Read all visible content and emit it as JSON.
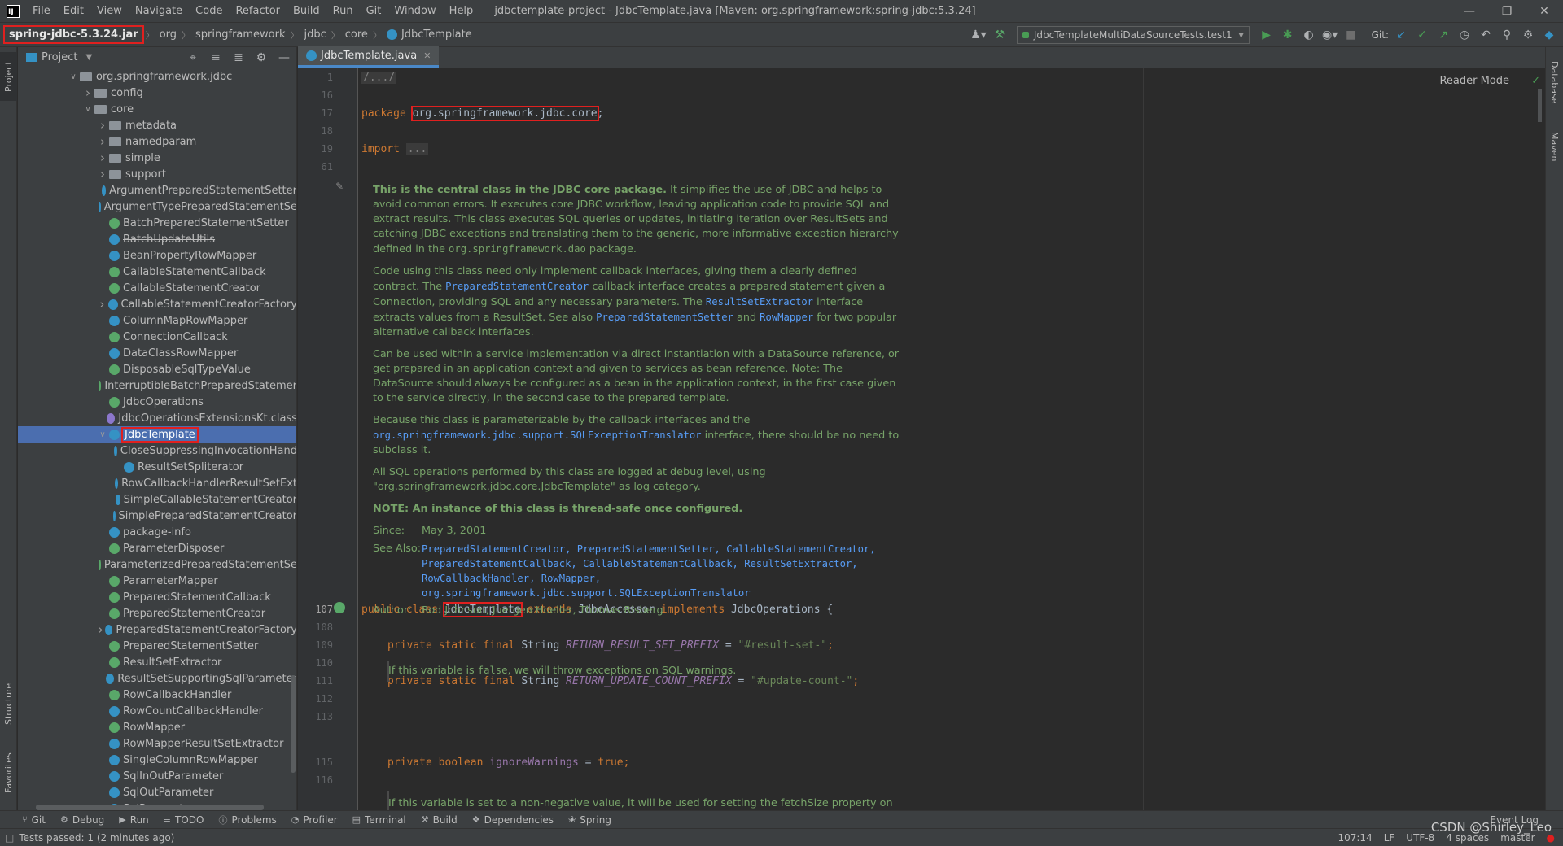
{
  "menubar": {
    "items": [
      "File",
      "Edit",
      "View",
      "Navigate",
      "Code",
      "Refactor",
      "Build",
      "Run",
      "Git",
      "Window",
      "Help"
    ],
    "window_title": "jdbctemplate-project - JdbcTemplate.java [Maven: org.springframework:spring-jdbc:5.3.24]"
  },
  "navbar": {
    "crumbs": [
      "spring-jdbc-5.3.24.jar",
      "org",
      "springframework",
      "jdbc",
      "core",
      "JdbcTemplate"
    ],
    "run_config": "JdbcTemplateMultiDataSourceTests.test1",
    "git_label": "Git:"
  },
  "left_stripe": {
    "project": "Project",
    "structure": "Structure",
    "favorites": "Favorites"
  },
  "right_stripe": {
    "database": "Database",
    "maven": "Maven"
  },
  "project_panel": {
    "title": "Project",
    "tree": [
      {
        "label": "org.springframework.jdbc",
        "type": "folder",
        "arrow": "down",
        "indent": 0
      },
      {
        "label": "config",
        "type": "folder",
        "arrow": "right",
        "indent": 1
      },
      {
        "label": "core",
        "type": "folder",
        "arrow": "down",
        "indent": 1
      },
      {
        "label": "metadata",
        "type": "folder",
        "arrow": "right",
        "indent": 2
      },
      {
        "label": "namedparam",
        "type": "folder",
        "arrow": "right",
        "indent": 2
      },
      {
        "label": "simple",
        "type": "folder",
        "arrow": "right",
        "indent": 2
      },
      {
        "label": "support",
        "type": "folder",
        "arrow": "right",
        "indent": 2
      },
      {
        "label": "ArgumentPreparedStatementSetter",
        "type": "class",
        "indent": 2
      },
      {
        "label": "ArgumentTypePreparedStatementSe",
        "type": "class",
        "indent": 2
      },
      {
        "label": "BatchPreparedStatementSetter",
        "type": "interface",
        "indent": 2
      },
      {
        "label": "BatchUpdateUtils",
        "type": "class",
        "indent": 2,
        "strike": true
      },
      {
        "label": "BeanPropertyRowMapper",
        "type": "class",
        "indent": 2
      },
      {
        "label": "CallableStatementCallback",
        "type": "interface",
        "indent": 2
      },
      {
        "label": "CallableStatementCreator",
        "type": "interface",
        "indent": 2
      },
      {
        "label": "CallableStatementCreatorFactory",
        "type": "class",
        "arrow": "right",
        "indent": 2
      },
      {
        "label": "ColumnMapRowMapper",
        "type": "class",
        "indent": 2
      },
      {
        "label": "ConnectionCallback",
        "type": "interface",
        "indent": 2
      },
      {
        "label": "DataClassRowMapper",
        "type": "class",
        "indent": 2
      },
      {
        "label": "DisposableSqlTypeValue",
        "type": "interface",
        "indent": 2
      },
      {
        "label": "InterruptibleBatchPreparedStatemer",
        "type": "interface",
        "indent": 2
      },
      {
        "label": "JdbcOperations",
        "type": "interface",
        "indent": 2
      },
      {
        "label": "JdbcOperationsExtensionsKt.class",
        "type": "kotlin",
        "indent": 2
      },
      {
        "label": "JdbcTemplate",
        "type": "class",
        "arrow": "down",
        "indent": 2,
        "selected": true
      },
      {
        "label": "CloseSuppressingInvocationHand",
        "type": "class",
        "indent": 3
      },
      {
        "label": "ResultSetSpliterator",
        "type": "class",
        "indent": 3
      },
      {
        "label": "RowCallbackHandlerResultSetExt",
        "type": "class",
        "indent": 3
      },
      {
        "label": "SimpleCallableStatementCreator",
        "type": "class",
        "indent": 3
      },
      {
        "label": "SimplePreparedStatementCreator",
        "type": "class",
        "indent": 3
      },
      {
        "label": "package-info",
        "type": "class",
        "indent": 2
      },
      {
        "label": "ParameterDisposer",
        "type": "interface",
        "indent": 2
      },
      {
        "label": "ParameterizedPreparedStatementSe",
        "type": "interface",
        "indent": 2
      },
      {
        "label": "ParameterMapper",
        "type": "interface",
        "indent": 2
      },
      {
        "label": "PreparedStatementCallback",
        "type": "interface",
        "indent": 2
      },
      {
        "label": "PreparedStatementCreator",
        "type": "interface",
        "indent": 2
      },
      {
        "label": "PreparedStatementCreatorFactory",
        "type": "class",
        "arrow": "right",
        "indent": 2
      },
      {
        "label": "PreparedStatementSetter",
        "type": "interface",
        "indent": 2
      },
      {
        "label": "ResultSetExtractor",
        "type": "interface",
        "indent": 2
      },
      {
        "label": "ResultSetSupportingSqlParameter",
        "type": "class",
        "indent": 2
      },
      {
        "label": "RowCallbackHandler",
        "type": "interface",
        "indent": 2
      },
      {
        "label": "RowCountCallbackHandler",
        "type": "class",
        "indent": 2
      },
      {
        "label": "RowMapper",
        "type": "interface",
        "indent": 2
      },
      {
        "label": "RowMapperResultSetExtractor",
        "type": "class",
        "indent": 2
      },
      {
        "label": "SingleColumnRowMapper",
        "type": "class",
        "indent": 2
      },
      {
        "label": "SqlInOutParameter",
        "type": "class",
        "indent": 2
      },
      {
        "label": "SqlOutParameter",
        "type": "class",
        "indent": 2
      },
      {
        "label": "SqlParameter",
        "type": "class",
        "indent": 2
      }
    ]
  },
  "editor": {
    "tab_label": "JdbcTemplate.java",
    "reader_mode": "Reader Mode",
    "fold_header": "/.../",
    "package_kw": "package",
    "package_name": "org.springframework.jdbc.core",
    "import_kw": "import",
    "import_fold": "...",
    "class_decl": {
      "mods": "public class",
      "name": "JdbcTemplate",
      "extends_kw": "extends",
      "parent": "JdbcAccessor",
      "implements_kw": "implements",
      "iface": "JdbcOperations {"
    },
    "field1": {
      "mods": "private static final",
      "type": "String",
      "name": "RETURN_RESULT_SET_PREFIX",
      "eq": " = ",
      "val": "\"#result-set-\"",
      "end": ";"
    },
    "field2": {
      "mods": "private static final",
      "type": "String",
      "name": "RETURN_UPDATE_COUNT_PREFIX",
      "eq": " = ",
      "val": "\"#update-count-\"",
      "end": ";"
    },
    "field3": {
      "mods": "private",
      "type": "boolean",
      "name": "ignoreWarnings",
      "eq": " = ",
      "val": "true",
      "end": ";"
    },
    "doc_warn_1": "If this variable is ",
    "doc_warn_false": "false",
    "doc_warn_2": ", we will throw exceptions on SQL warnings.",
    "doc_fetch": "If this variable is set to a non-negative value, it will be used for setting the fetchSize property on",
    "line_numbers": [
      "1",
      "16",
      "17",
      "18",
      "19",
      "61",
      "107",
      "108",
      "109",
      "110",
      "111",
      "112",
      "113",
      "115",
      "116"
    ],
    "doc": {
      "p1_bold": "This is the central class in the JDBC core package.",
      "p1_rest": " It simplifies the use of JDBC and helps to avoid common errors. It executes core JDBC workflow, leaving application code to provide SQL and extract results. This class executes SQL queries or updates, initiating iteration over ResultSets and catching JDBC exceptions and translating them to the generic, more informative exception hierarchy defined in the ",
      "p1_code": "org.springframework.dao",
      "p1_end": " package.",
      "p2_a": "Code using this class need only implement callback interfaces, giving them a clearly defined contract. The ",
      "p2_l1": "PreparedStatementCreator",
      "p2_b": " callback interface creates a prepared statement given a Connection, providing SQL and any necessary parameters. The ",
      "p2_l2": "ResultSetExtractor",
      "p2_c": " interface extracts values from a ResultSet. See also ",
      "p2_l3": "PreparedStatementSetter",
      "p2_d": " and ",
      "p2_l4": "RowMapper",
      "p2_e": " for two popular alternative callback interfaces.",
      "p3": "Can be used within a service implementation via direct instantiation with a DataSource reference, or get prepared in an application context and given to services as bean reference. Note: The DataSource should always be configured as a bean in the application context, in the first case given to the service directly, in the second case to the prepared template.",
      "p4_a": "Because this class is parameterizable by the callback interfaces and the ",
      "p4_l": "org.springframework.jdbc.support.SQLExceptionTranslator",
      "p4_b": " interface, there should be no need to subclass it.",
      "p5": "All SQL operations performed by this class are logged at debug level, using \"org.springframework.jdbc.core.JdbcTemplate\" as log category.",
      "p6": "NOTE: An instance of this class is thread-safe once configured.",
      "since_k": "Since:",
      "since_v": "May 3, 2001",
      "see_k": "See Also:",
      "see_v": "PreparedStatementCreator, PreparedStatementSetter, CallableStatementCreator, PreparedStatementCallback, CallableStatementCallback, ResultSetExtractor, RowCallbackHandler, RowMapper, org.springframework.jdbc.support.SQLExceptionTranslator",
      "author_k": "Author:",
      "author_v": "Rod Johnson, Juergen Hoeller, Thomas Risberg"
    }
  },
  "bottom_tools": [
    "Git",
    "Debug",
    "Run",
    "TODO",
    "Problems",
    "Profiler",
    "Terminal",
    "Build",
    "Dependencies",
    "Spring"
  ],
  "event_log": "Event Log",
  "status": {
    "left": "Tests passed: 1 (2 minutes ago)",
    "position": "107:14",
    "line_sep": "LF",
    "encoding": "UTF-8",
    "indent": "4 spaces",
    "branch": "master"
  },
  "watermark": "CSDN @Shirley_Leo"
}
